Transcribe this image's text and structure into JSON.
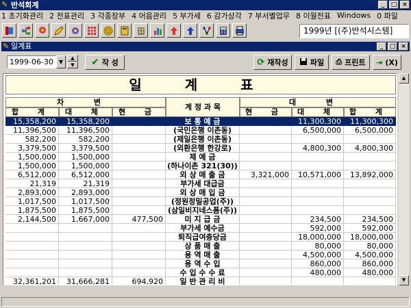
{
  "window": {
    "title": "반석회계"
  },
  "menu": [
    "1 초기화관리",
    "2 전표관리",
    "3 각종장부",
    "4 어음관리",
    "5 부가세",
    "6 감가상각",
    "7 부서별업무",
    "8 이월전표",
    "Windows",
    "0 파일"
  ],
  "company": "1999년 [(주)반석시스템]",
  "child": {
    "title": "일계표"
  },
  "controls": {
    "date": "1999-06-30",
    "write": "작 성",
    "rewrite": "재작성",
    "file": "파일",
    "print": "프린트",
    "exit": "(X)"
  },
  "sheet": {
    "banner": "일 계 표",
    "debit": "차 변",
    "credit": "대 변",
    "account": "계 정 과 목",
    "debit_cols": [
      "합 계",
      "대 체",
      "현 금"
    ],
    "credit_cols": [
      "현 금",
      "대 체",
      "합 계"
    ]
  },
  "rows": [
    {
      "dt": "15,358,200",
      "dr": "15,358,200",
      "dc": "",
      "acct": "보 통 예 금",
      "cc": "",
      "cr": "11,300,300",
      "ct": "11,300,300"
    },
    {
      "dt": "11,396,500",
      "dr": "11,396,500",
      "dc": "",
      "acct": "(국민은행 이촌동)",
      "cc": "",
      "cr": "6,500,000",
      "ct": "6,500,000"
    },
    {
      "dt": "582,200",
      "dr": "582,200",
      "dc": "",
      "acct": "(제일은행 이촌동)",
      "cc": "",
      "cr": "",
      "ct": ""
    },
    {
      "dt": "3,379,500",
      "dr": "3,379,500",
      "dc": "",
      "acct": "(외환은행 한강로)",
      "cc": "",
      "cr": "4,800,300",
      "ct": "4,800,300"
    },
    {
      "dt": "1,500,000",
      "dr": "1,500,000",
      "dc": "",
      "acct": "제 예 금",
      "cc": "",
      "cr": "",
      "ct": ""
    },
    {
      "dt": "1,500,000",
      "dr": "1,500,000",
      "dc": "",
      "acct": "(하나이촌 321(30))",
      "cc": "",
      "cr": "",
      "ct": ""
    },
    {
      "dt": "6,512,000",
      "dr": "6,512,000",
      "dc": "",
      "acct": "외 상 매 출 금",
      "cc": "3,321,000",
      "cr": "10,571,000",
      "ct": "13,892,000"
    },
    {
      "dt": "21,319",
      "dr": "21,319",
      "dc": "",
      "acct": "부가세 대급금",
      "cc": "",
      "cr": "",
      "ct": ""
    },
    {
      "dt": "2,893,000",
      "dr": "2,893,000",
      "dc": "",
      "acct": "외 상 매 입 금",
      "cc": "",
      "cr": "",
      "ct": ""
    },
    {
      "dt": "1,017,500",
      "dr": "1,017,500",
      "dc": "",
      "acct": "(정원정밀공업(주))",
      "cc": "",
      "cr": "",
      "ct": ""
    },
    {
      "dt": "1,875,500",
      "dr": "1,875,500",
      "dc": "",
      "acct": "(삼일비지네스폼(주))",
      "cc": "",
      "cr": "",
      "ct": ""
    },
    {
      "dt": "2,144,500",
      "dr": "1,667,000",
      "dc": "477,500",
      "acct": "미 지 급 금",
      "cc": "",
      "cr": "234,500",
      "ct": "234,500"
    },
    {
      "dt": "",
      "dr": "",
      "dc": "",
      "acct": "부가세 예수금",
      "cc": "",
      "cr": "592,000",
      "ct": "592,000"
    },
    {
      "dt": "",
      "dr": "",
      "dc": "",
      "acct": "퇴직급여충당금",
      "cc": "",
      "cr": "18,000,000",
      "ct": "18,000,000"
    },
    {
      "dt": "",
      "dr": "",
      "dc": "",
      "acct": "상 품 매 출",
      "cc": "",
      "cr": "80,000",
      "ct": "80,000"
    },
    {
      "dt": "",
      "dr": "",
      "dc": "",
      "acct": "용 역 매 출",
      "cc": "",
      "cr": "4,500,000",
      "ct": "4,500,000"
    },
    {
      "dt": "",
      "dr": "",
      "dc": "",
      "acct": "용 역 수 입",
      "cc": "",
      "cr": "860,000",
      "ct": "860,000"
    },
    {
      "dt": "",
      "dr": "",
      "dc": "",
      "acct": "수 입 수 수 료",
      "cc": "",
      "cr": "480,000",
      "ct": "480,000"
    },
    {
      "dt": "32,361,201",
      "dr": "31,666,281",
      "dc": "694,920",
      "acct": "일 반 관 리 비",
      "cc": "",
      "cr": "",
      "ct": ""
    }
  ],
  "selected_row": 0,
  "colors": {
    "titlebar": "#0a246a",
    "header_bg": "#fffbe0",
    "face": "#d4d0c8"
  },
  "icons": [
    "folder-icon",
    "tree-icon",
    "balloon-icon",
    "pencil-icon",
    "gear-icon",
    "grid-icon",
    "coin-icon",
    "book-icon",
    "building-icon",
    "chart-icon",
    "arrow-up-red-icon",
    "arrow-up-blue-icon",
    "network-icon",
    "calculator-icon",
    "printer-icon"
  ]
}
